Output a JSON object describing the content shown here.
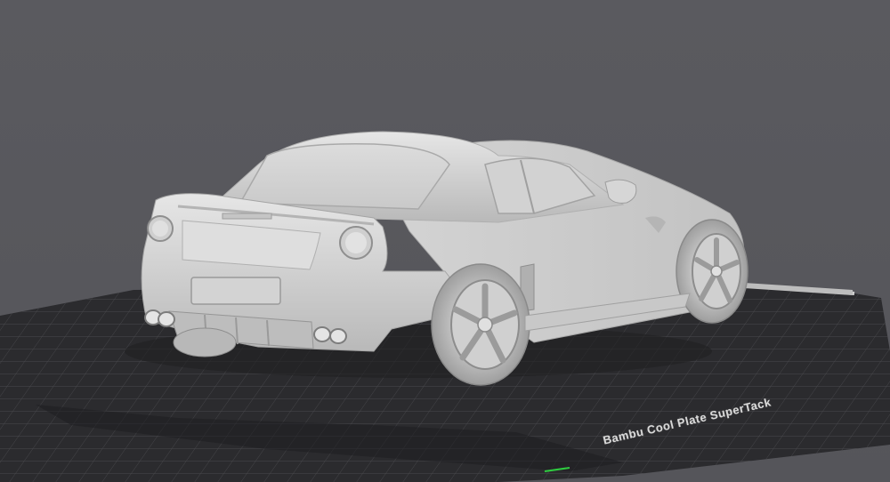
{
  "viewport": {
    "background_color": "#59595e",
    "bed_color": "#2b2b2e",
    "bed_grid_color": "#4a4a4e",
    "model_color": "#d8d8d8"
  },
  "bed": {
    "label": "Bambu Cool Plate SuperTack"
  },
  "model": {
    "name": "car-model"
  },
  "axes": {
    "origin_indicator_color": "#2ecc40"
  }
}
